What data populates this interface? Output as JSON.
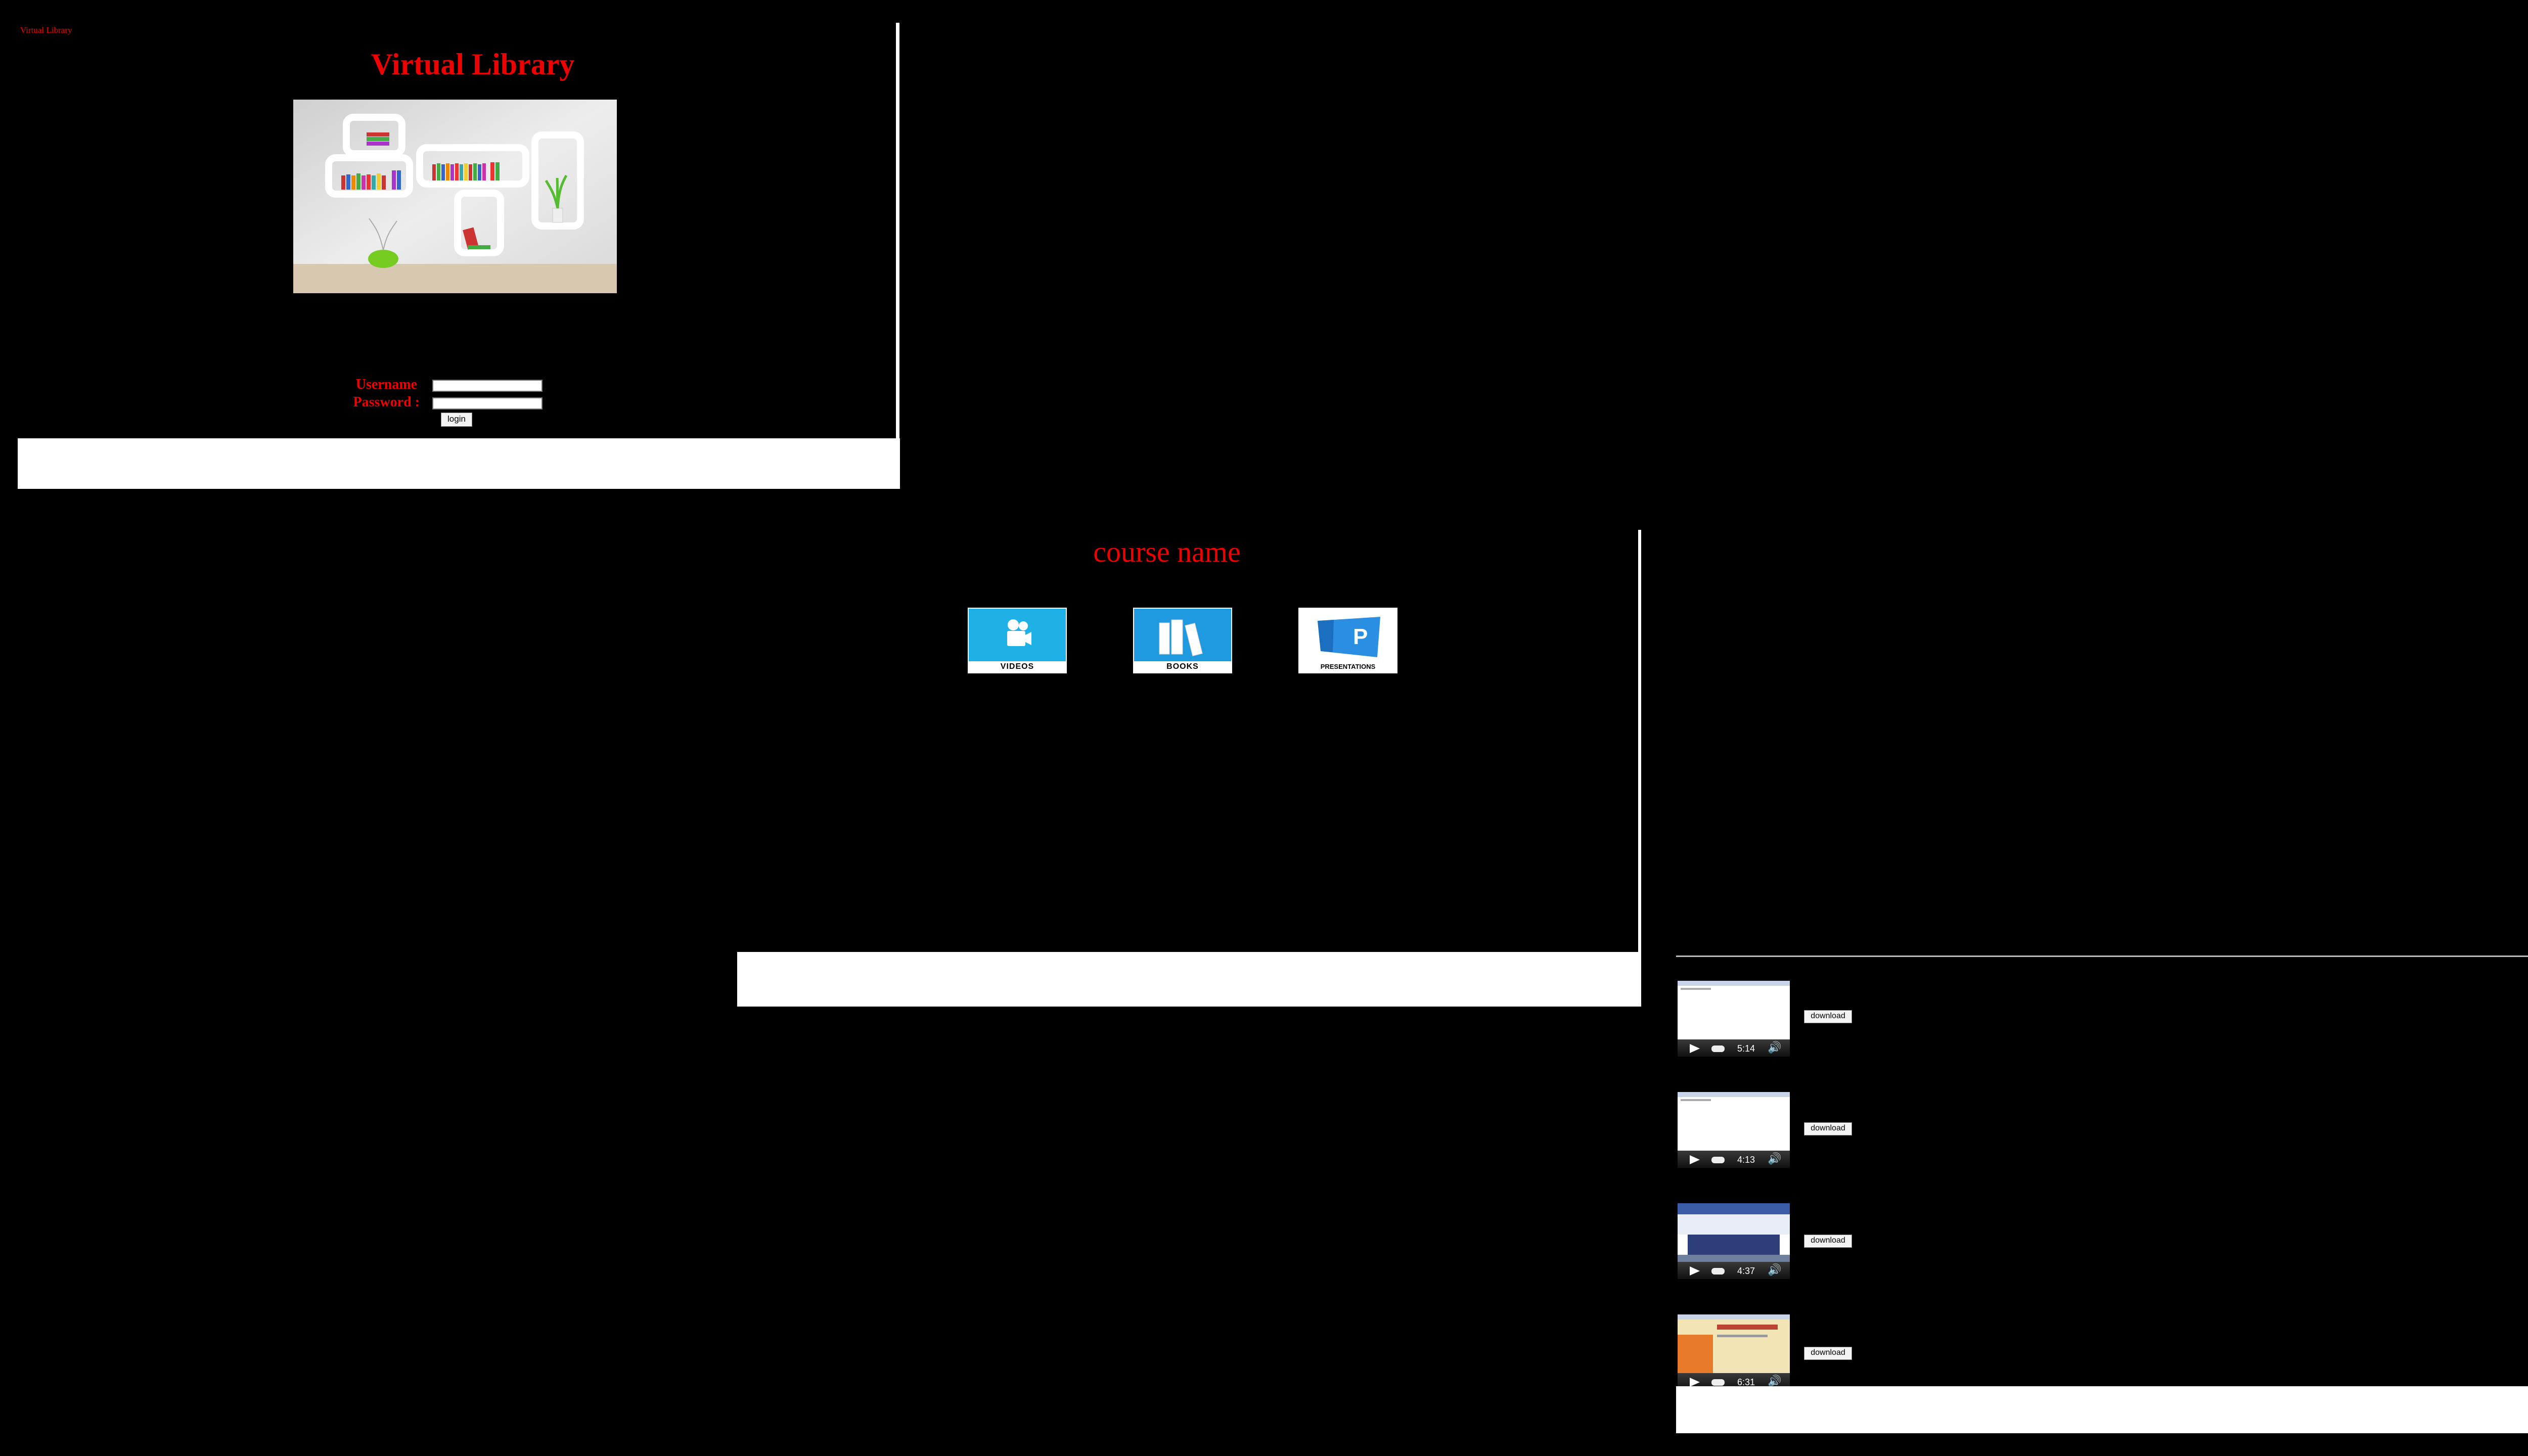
{
  "login_window": {
    "tab_title": "Virtual Library",
    "heading": "Virtual Library",
    "image_desc": "bookshelf-illustration",
    "username_label": "Username",
    "password_label": "Password :",
    "username_value": "",
    "password_value": "",
    "login_button": "login",
    "accent_color": "#ee0000"
  },
  "course_window": {
    "heading": "course name",
    "tiles": [
      {
        "label": "VIDEOS",
        "icon": "video-camera-icon",
        "color": "#1fb0e6"
      },
      {
        "label": "BOOKS",
        "icon": "books-icon",
        "color": "#1f9ae0"
      },
      {
        "label": "PRESENTATIONS",
        "icon": "presentation-icon",
        "color": "#2a8fe3"
      }
    ]
  },
  "video_window": {
    "videos": [
      {
        "duration": "5:14",
        "download_label": "download"
      },
      {
        "duration": "4:13",
        "download_label": "download"
      },
      {
        "duration": "4:37",
        "download_label": "download"
      },
      {
        "duration": "6:31",
        "download_label": "download"
      }
    ]
  }
}
